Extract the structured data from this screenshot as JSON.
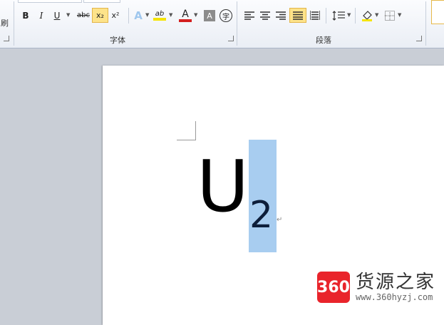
{
  "ribbon": {
    "left_fragment": "刷",
    "groups": {
      "font_label": "字体",
      "paragraph_label": "段落"
    },
    "font_buttons": {
      "bold": "B",
      "italic": "I",
      "underline": "U",
      "strikethrough": "abc",
      "subscript": "x₂",
      "superscript": "x²",
      "text_effect": "A",
      "highlight": "ab",
      "font_color": "A",
      "char_shading": "A",
      "enclose": "字"
    },
    "colors": {
      "font_color_bar": "#d31f1f",
      "highlight_bar": "#f5e400",
      "active_bg": "#fde38a"
    }
  },
  "document": {
    "main_char": "U",
    "subscript_char": "2",
    "paragraph_mark": "↵",
    "selection_color": "#a8cdf0"
  },
  "watermark": {
    "badge": "360",
    "name": "货源之家",
    "url": "www.360hyzj.com"
  }
}
